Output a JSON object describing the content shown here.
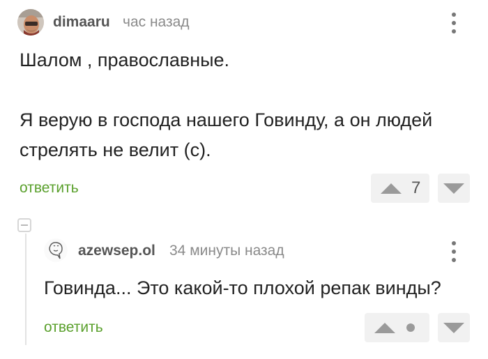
{
  "comment": {
    "author": "dimaaru",
    "time": "час назад",
    "text": "Шалом , православные.\n\nЯ верую в господа нашего Говинду, а он людей\nстрелять не велит (с).",
    "reply_label": "ответить",
    "rating": "7"
  },
  "reply": {
    "author": "azewsep.ol",
    "time": "34 минуты назад",
    "text": "Говинда... Это какой-то плохой репак винды?",
    "reply_label": "ответить"
  },
  "icons": {
    "menu": "kebab-menu-icon",
    "upvote": "triangle-up-icon",
    "downvote": "triangle-down-icon",
    "collapse": "minus-icon"
  },
  "colors": {
    "reply_link": "#5aa02c",
    "vote_bg": "#f1f1f1",
    "icon_gray": "#9a9a9a"
  }
}
